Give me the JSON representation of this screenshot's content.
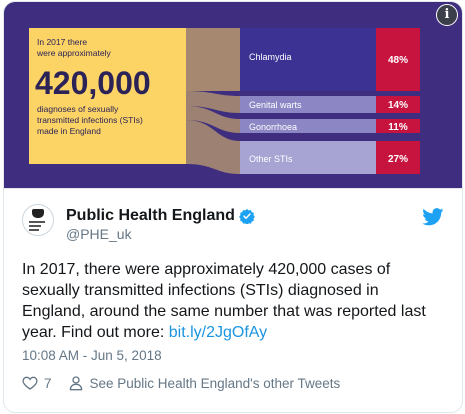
{
  "infographic": {
    "intro_line1": "In 2017 there",
    "intro_line2": "were approximately",
    "big_number": "420,000",
    "desc_line1": "diagnoses of sexually",
    "desc_line2": "transmitted infections (STIs)",
    "desc_line3": "made in England",
    "colors": {
      "background": "#3f2e7f",
      "panel": "#fcd365",
      "band_chlamydia": "#3b3293",
      "band_light": "#8c87c4",
      "pct_box": "#c6143f"
    },
    "rows": [
      {
        "label": "Chlamydia",
        "pct": "48%"
      },
      {
        "label": "Genital warts",
        "pct": "14%"
      },
      {
        "label": "Gonorrhoea",
        "pct": "11%"
      },
      {
        "label": "Other STIs",
        "pct": "27%"
      }
    ],
    "info_glyph": "i"
  },
  "tweet": {
    "display_name": "Public Health England",
    "handle": "@PHE_uk",
    "text": "In 2017, there were approximately 420,000 cases of sexually transmitted infections (STIs) diagnosed in England, around the same number that was reported last year. Find out more: ",
    "link_text": "bit.ly/2JgOfAy",
    "timestamp": "10:08 AM - Jun 5, 2018",
    "like_count": "7",
    "see_more": "See Public Health England's other Tweets",
    "colors": {
      "link": "#1b95e0",
      "verified": "#1da1f2",
      "twitter": "#1da1f2"
    }
  }
}
